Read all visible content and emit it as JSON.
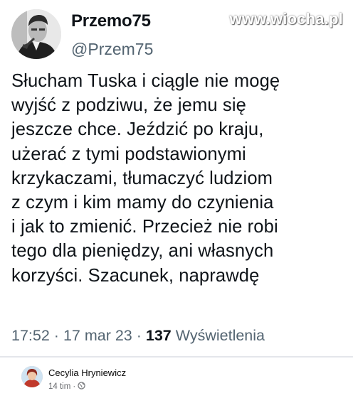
{
  "watermark": "www.wiocha.pl",
  "tweet": {
    "display_name": "Przemo75",
    "handle": "@Przem75",
    "text_lines": [
      "Słucham Tuska i ciągle nie mogę",
      "wyjść z podziwu, że jemu się",
      "jeszcze chce. Jeździć po kraju,",
      "użerać z tymi podstawionymi",
      "krzykaczami, tłumaczyć ludziom",
      "z czym i kim mamy do czynienia",
      "i jak to zmienić. Przecież nie robi",
      "tego dla pieniędzy, ani własnych",
      "korzyści. Szacunek, naprawdę"
    ],
    "time": "17:52",
    "date": "17 mar 23",
    "views_count": "137",
    "views_label": "Wyświetlenia"
  },
  "facebook_post": {
    "author": "Cecylia Hryniewicz",
    "time": "14 tim",
    "separator": "·",
    "audience_icon": "globe-icon"
  }
}
